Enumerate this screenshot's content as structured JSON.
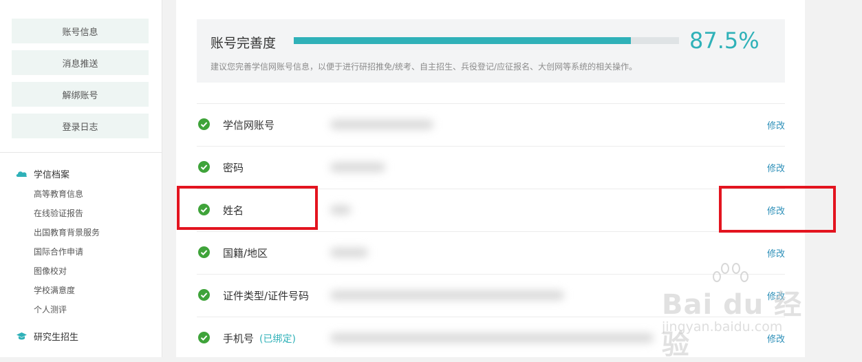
{
  "sidebar": {
    "buttons": [
      "账号信息",
      "消息推送",
      "解绑账号",
      "登录日志"
    ],
    "sections": [
      {
        "title": "学信档案",
        "icon": "cloud-icon",
        "items": [
          "高等教育信息",
          "在线验证报告",
          "出国教育背景服务",
          "国际合作申请",
          "图像校对",
          "学校满意度",
          "个人测评"
        ]
      },
      {
        "title": "研究生招生",
        "icon": "graduation-cap-icon"
      }
    ]
  },
  "completion": {
    "label": "账号完善度",
    "percent_text": "87.5%",
    "percent": 87.5,
    "note": "建议您完善学信网账号信息，以便于进行研招推免/统考、自主招生、兵役登记/应征报名、大创网等系统的相关操作。"
  },
  "rows": [
    {
      "name": "学信网账号",
      "edit": "修改"
    },
    {
      "name": "密码",
      "edit": "修改"
    },
    {
      "name": "姓名",
      "edit": "修改"
    },
    {
      "name": "国籍/地区",
      "edit": "修改"
    },
    {
      "name": "证件类型/证件号码",
      "edit": "修改"
    },
    {
      "name": "手机号",
      "bound": "(已绑定)",
      "edit": "修改"
    }
  ],
  "watermark": {
    "logo": "Bai du 经验",
    "url": "jingyan.baidu.com"
  },
  "colors": {
    "accent": "#2fb1b8",
    "link": "#2c8fb8",
    "check": "#3fa33a",
    "highlight": "#e3141f"
  }
}
